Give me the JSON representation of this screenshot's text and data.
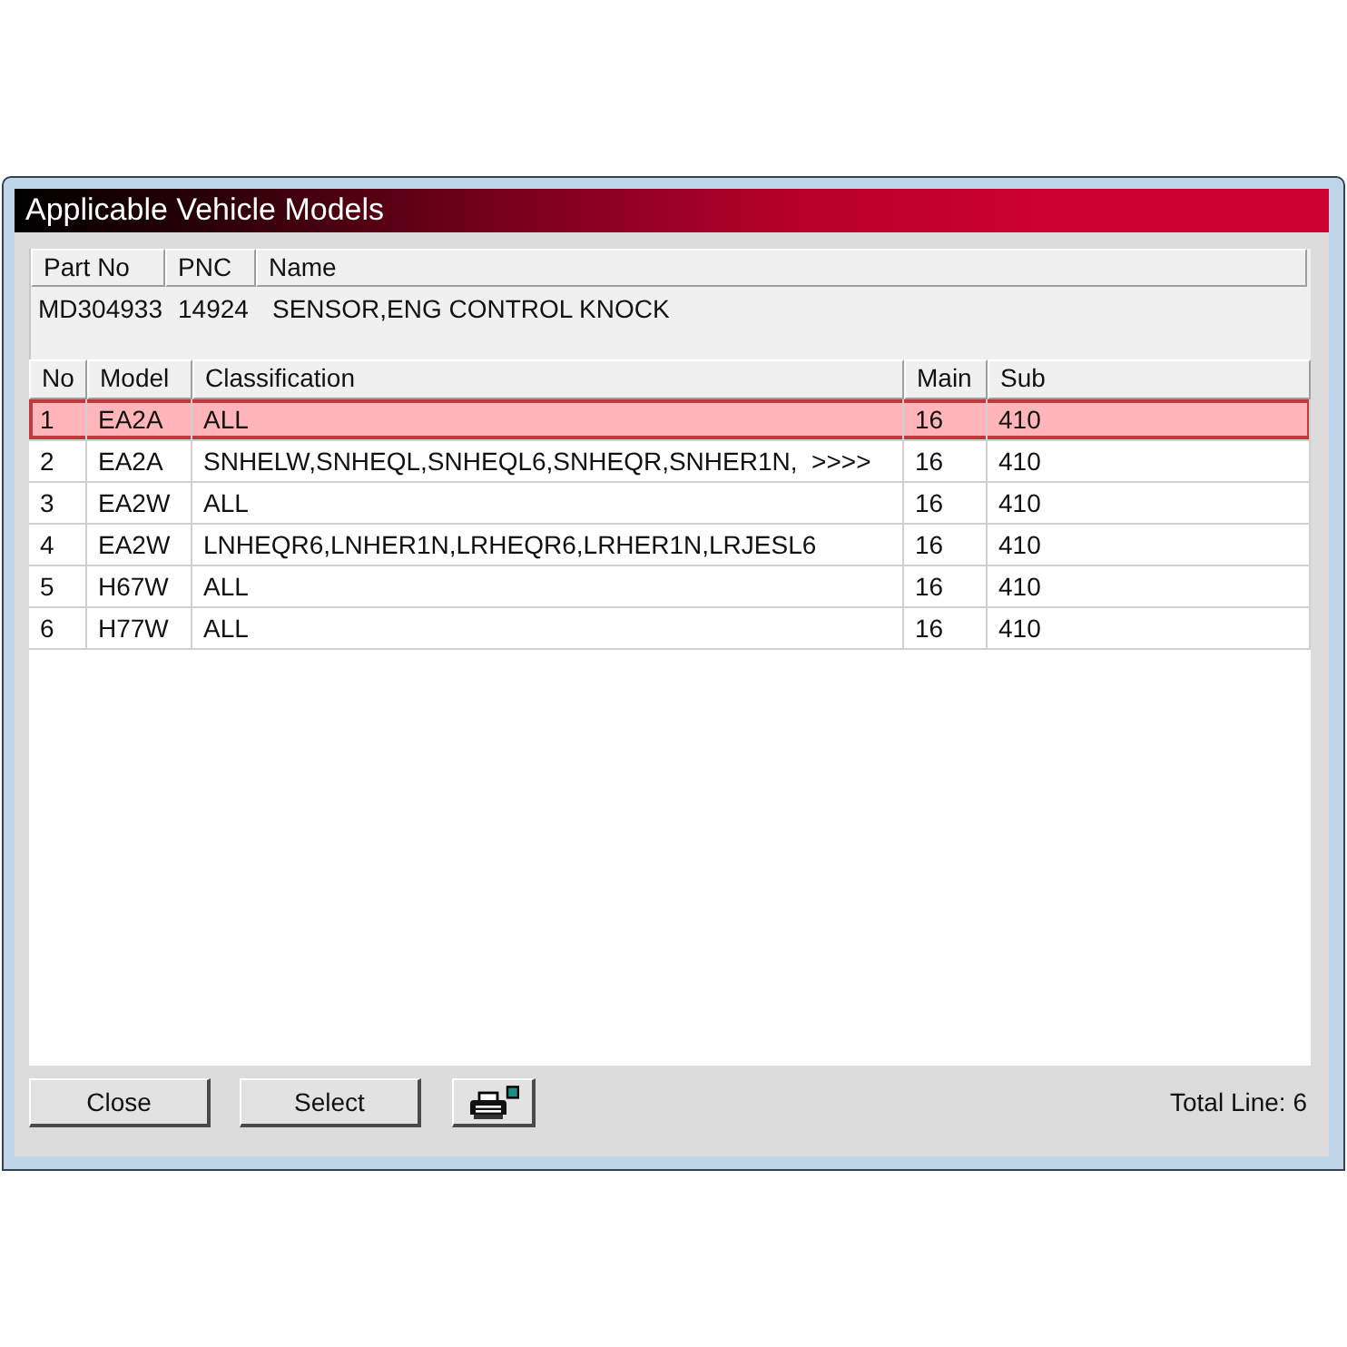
{
  "window": {
    "title": "Applicable Vehicle Models"
  },
  "part": {
    "columns": [
      "Part No",
      "PNC",
      "Name"
    ],
    "values": [
      "MD304933",
      "14924",
      "SENSOR,ENG CONTROL KNOCK"
    ]
  },
  "table": {
    "columns": [
      "No",
      "Model",
      "Classification",
      "Main",
      "Sub"
    ],
    "rows": [
      {
        "cells": [
          "1",
          "EA2A",
          "ALL",
          "16",
          "410"
        ],
        "selected": true
      },
      {
        "cells": [
          "2",
          "EA2A",
          "SNHELW,SNHEQL,SNHEQL6,SNHEQR,SNHER1N,  >>>>",
          "16",
          "410"
        ],
        "selected": false
      },
      {
        "cells": [
          "3",
          "EA2W",
          "ALL",
          "16",
          "410"
        ],
        "selected": false
      },
      {
        "cells": [
          "4",
          "EA2W",
          "LNHEQR6,LNHER1N,LRHEQR6,LRHER1N,LRJESL6",
          "16",
          "410"
        ],
        "selected": false
      },
      {
        "cells": [
          "5",
          "H67W",
          "ALL",
          "16",
          "410"
        ],
        "selected": false
      },
      {
        "cells": [
          "6",
          "H77W",
          "ALL",
          "16",
          "410"
        ],
        "selected": false
      }
    ]
  },
  "buttons": [
    {
      "kind": "text",
      "label": "Close"
    },
    {
      "kind": "text",
      "label": "Select"
    },
    {
      "kind": "print"
    }
  ],
  "status": "Total Line: 6"
}
